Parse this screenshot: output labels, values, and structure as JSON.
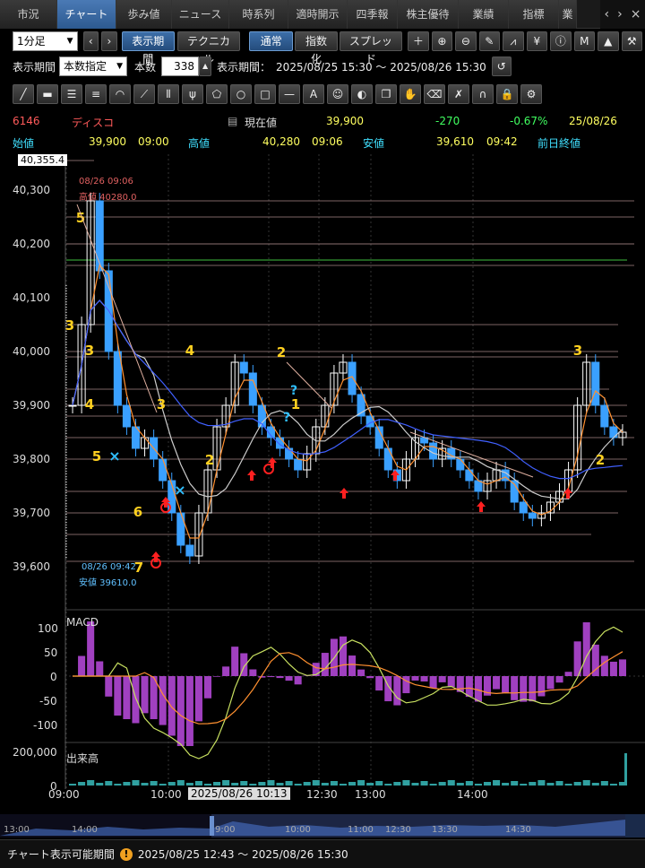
{
  "tabs": [
    "市況",
    "チャート",
    "歩み値",
    "ニュース",
    "時系列",
    "適時開示",
    "四季報",
    "株主優待",
    "業績",
    "指標",
    "業績"
  ],
  "toolbar1": {
    "timeframe": "1分足",
    "period_btn": "表示期間",
    "tech_btn": "テクニカル",
    "normal_btn": "通常",
    "index_btn": "指数化",
    "spread_btn": "スプレッド"
  },
  "toolbar2": {
    "period_label": "表示期間",
    "period_mode": "本数指定",
    "count_label": "本数",
    "count_value": "338",
    "range_label": "表示期間：",
    "range_value": "2025/08/25 15:30 〜 2025/08/26 15:30"
  },
  "quote": {
    "code": "6146",
    "name": "ディスコ",
    "current_label": "現在値",
    "current": "39,900",
    "change": "-270",
    "change_pct": "-0.67%",
    "date": "25/08/26",
    "open_label": "始値",
    "open": "39,900",
    "open_time": "09:00",
    "high_label": "高値",
    "high": "40,280",
    "high_time": "09:06",
    "low_label": "安値",
    "low": "39,610",
    "low_time": "09:42",
    "prev_label": "前日終値"
  },
  "price_axis": {
    "top_marker": "40,355.4",
    "ticks": [
      "40,300",
      "40,200",
      "40,100",
      "40,000",
      "39,900",
      "39,800",
      "39,700",
      "39,600"
    ]
  },
  "annotations": {
    "high_time": "08/26 09:06",
    "high_text": "高値 40280.0",
    "low_time": "08/26 09:42",
    "low_text": "安値 39610.0"
  },
  "macd": {
    "label": "MACD",
    "ticks": [
      "100",
      "50",
      "0",
      "-50",
      "-100"
    ]
  },
  "volume": {
    "label": "出来高",
    "ticks": [
      "200,000",
      "0"
    ]
  },
  "time_axis": {
    "ticks": [
      "09:00",
      "10:00",
      "12:30",
      "13:00",
      "14:00"
    ],
    "cursor": "2025/08/26 10:13"
  },
  "navigator": {
    "ticks": [
      "13:00",
      "14:00",
      "9:00",
      "10:00",
      "11:00",
      "12:30",
      "13:30",
      "14:30"
    ]
  },
  "footer": {
    "label": "チャート表示可能期間",
    "range": "2025/08/25 12:43 〜 2025/08/26 15:30"
  },
  "colors": {
    "up": "#ffffff",
    "down": "#3aa0ff",
    "ma_short": "#e8a040",
    "ma_long": "#4060ff",
    "ma_mid": "#cccccc",
    "macd": "#c8e060",
    "signal": "#ff9030",
    "hist": "#a040c0",
    "green_line": "#40c040"
  }
}
